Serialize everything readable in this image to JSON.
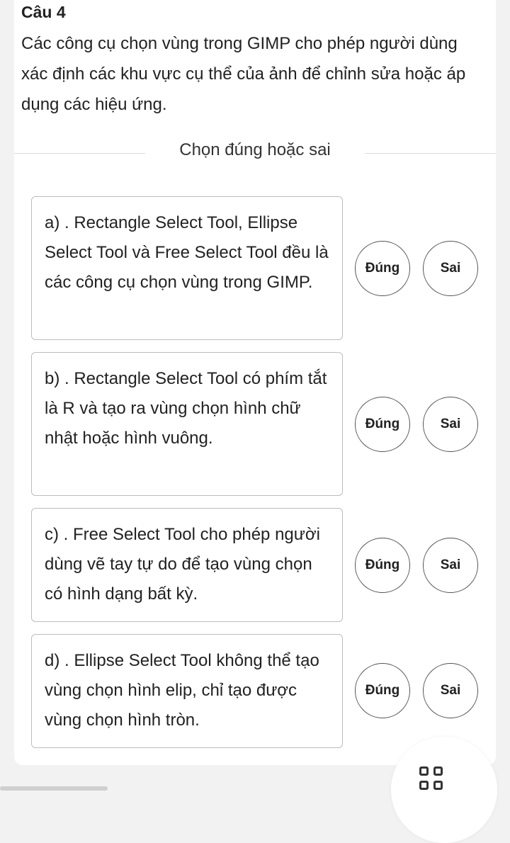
{
  "question": {
    "title": "Câu 4",
    "text": "Các công cụ chọn vùng trong GIMP cho phép người dùng xác định các khu vực cụ thể của ảnh để chỉnh sửa hoặc áp dụng các hiệu ứng.",
    "section_label": "Chọn đúng hoặc sai"
  },
  "statements": [
    {
      "text": "a) . Rectangle Select Tool, Ellipse Select Tool và Free Select Tool đều là các công cụ chọn vùng trong GIMP.",
      "true_label": "Đúng",
      "false_label": "Sai"
    },
    {
      "text": "b) . Rectangle Select Tool có phím tắt là R và tạo ra vùng chọn hình chữ nhật hoặc hình vuông.",
      "true_label": "Đúng",
      "false_label": "Sai"
    },
    {
      "text": "c) . Free Select Tool cho phép người dùng vẽ tay tự do để tạo vùng chọn có hình dạng bất kỳ.",
      "true_label": "Đúng",
      "false_label": "Sai"
    },
    {
      "text": "d) . Ellipse Select Tool không thể tạo vùng chọn hình elip, chỉ tạo được vùng chọn hình tròn.",
      "true_label": "Đúng",
      "false_label": "Sai"
    }
  ],
  "fab": {
    "icon": "grid-icon"
  }
}
